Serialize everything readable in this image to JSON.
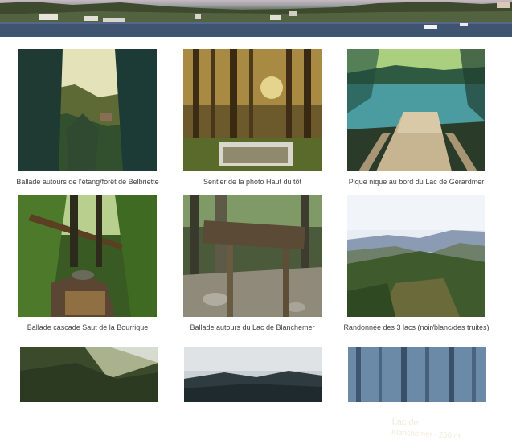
{
  "gallery": {
    "items": [
      {
        "caption": "Ballade autours de l'étang/forêt de Belbriette"
      },
      {
        "caption": "Sentier de la photo Haut du tôt"
      },
      {
        "caption": "Pique nique au bord du Lac de Gérardmer"
      },
      {
        "caption": "Ballade cascade Saut de la Bourrique"
      },
      {
        "caption": "Ballade autours du Lac de Blanchemer"
      },
      {
        "caption": "Randonnée des 3 lacs  (noir/blanc/des truites)"
      }
    ],
    "sign_text": [
      "Lac de",
      "Blanchemer - 200 m"
    ]
  }
}
